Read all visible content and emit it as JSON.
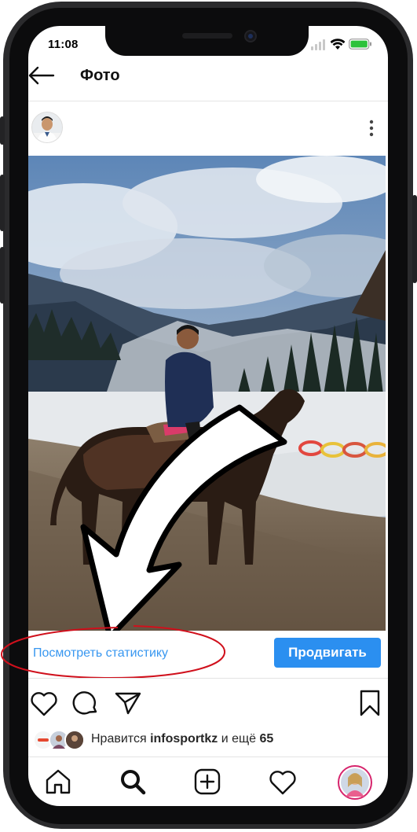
{
  "status_bar": {
    "time": "11:08"
  },
  "header": {
    "title": "Фото"
  },
  "post": {
    "stats_link": "Посмотреть статистику",
    "promote_button": "Продвигать",
    "likes": {
      "prefix": "Нравится",
      "user": "infosportkz",
      "middle": "и ещё",
      "count": "65"
    }
  },
  "icons": {
    "back": "arrow-left-icon",
    "more": "more-vertical-icon",
    "like": "heart-icon",
    "comment": "comment-icon",
    "share": "send-icon",
    "save": "bookmark-icon",
    "nav_home": "home-icon",
    "nav_search": "search-icon",
    "nav_add": "add-icon",
    "nav_activity": "heart-icon",
    "nav_profile": "avatar"
  },
  "colors": {
    "accent": "#3897f0",
    "button": "#2b8ff0",
    "annotation": "#d0101c"
  }
}
